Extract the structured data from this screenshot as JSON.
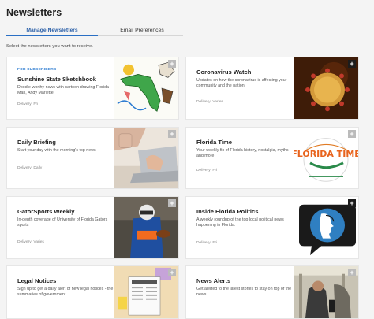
{
  "header": {
    "title": "Newsletters"
  },
  "tabs": [
    {
      "label": "Manage Newsletters"
    },
    {
      "label": "Email Preferences"
    }
  ],
  "instructions": "Select the newsletters you want to receive.",
  "add_icon": "+",
  "cards": [
    {
      "kicker": "FOR SUBSCRIBERS",
      "title": "Sunshine State Sketchbook",
      "description": "Doodle-worthy news with cartoon-drawing Florida Man, Andy Marlette",
      "delivery": "Delivery: Fri",
      "image_icon": "florida-cartoon-image"
    },
    {
      "title": "Coronavirus Watch",
      "description": "Updates on how the coronavirus is affecting your community and the nation",
      "delivery": "Delivery: Varies",
      "image_icon": "coronavirus-image"
    },
    {
      "title": "Daily Briefing",
      "description": "Start your day with the morning's top news",
      "delivery": "Delivery: Daily",
      "image_icon": "laptop-coffee-image"
    },
    {
      "title": "Florida Time",
      "description": "Your weekly fix of Florida history, nostalgia, myths and more",
      "delivery": "Delivery: Fri",
      "image_icon": "florida-time-logo-image",
      "logo_text": "FLORIDA TIME"
    },
    {
      "title": "GatorSports Weekly",
      "description": "In-depth coverage of University of Florida Gators sports",
      "delivery": "Delivery: Varies",
      "image_icon": "football-player-image"
    },
    {
      "title": "Inside Florida Politics",
      "description": "A weekly roundup of the top local political news happening in Florida.",
      "delivery": "Delivery: Fri",
      "image_icon": "politics-speech-bubble-image"
    },
    {
      "title": "Legal Notices",
      "description": "Sign up to get a daily alert of new legal notices - the summaries of government ...",
      "delivery": "Delivery: Daily",
      "image_icon": "newspaper-image"
    },
    {
      "title": "News Alerts",
      "description": "Get alerted to the latest stories to stay on top of the news.",
      "delivery": "Delivery: Varies",
      "image_icon": "subway-phone-image"
    }
  ],
  "colors": {
    "accent": "#2a6fc4",
    "kicker": "#2a7ad0",
    "add_button": "#bbbbbb"
  }
}
